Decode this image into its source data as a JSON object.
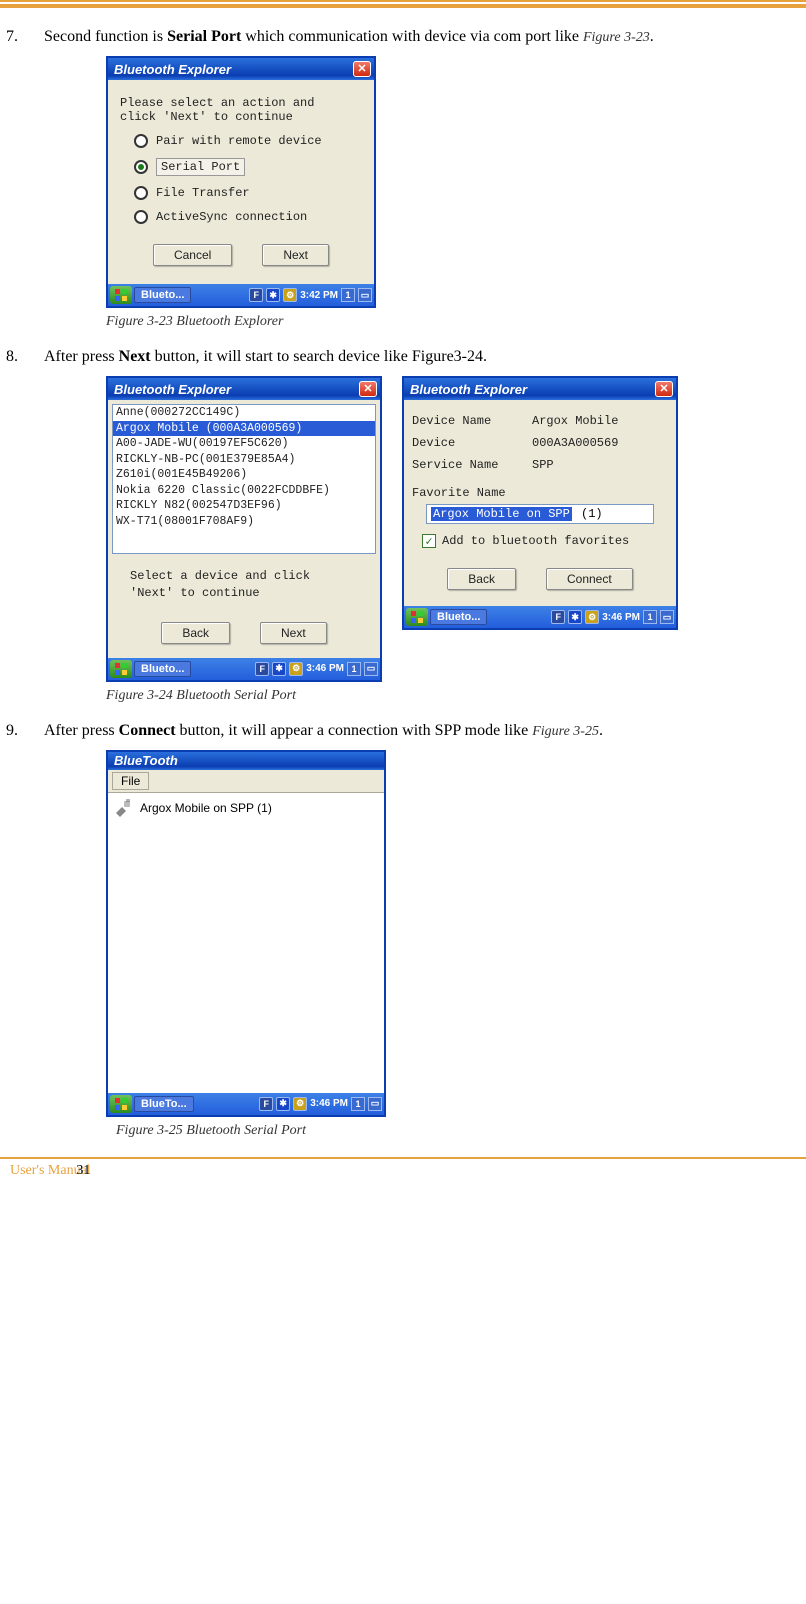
{
  "step7": {
    "num": "7.",
    "text_a": " Second function is ",
    "bold": "Serial Port",
    "text_b": " which communication with device via com port like ",
    "figref": "Figure 3-23",
    "text_c": "."
  },
  "fig23": {
    "title": "Bluetooth Explorer",
    "instr_a": "Please select an action and",
    "instr_b": "click 'Next'  to continue",
    "opt1": "Pair with remote device",
    "opt2": "Serial Port",
    "opt3": "File Transfer",
    "opt4": "ActiveSync connection",
    "cancel": "Cancel",
    "next": "Next",
    "task": "Blueto...",
    "clock": "3:42 PM",
    "caption": "Figure 3-23 Bluetooth Explorer"
  },
  "step8": {
    "num": "8.",
    "text_a": "After press ",
    "bold": "Next",
    "text_b": " button, it will start to search device like Figure3-24."
  },
  "fig24L": {
    "title": "Bluetooth Explorer",
    "devices": [
      "Anne(000272CC149C)",
      "Argox Mobile (000A3A000569)",
      "A00-JADE-WU(00197EF5C620)",
      "RICKLY-NB-PC(001E379E85A4)",
      "Z610i(001E45B49206)",
      "Nokia 6220 Classic(0022FCDDBFE)",
      "RICKLY N82(002547D3EF96)",
      "WX-T71(08001F708AF9)"
    ],
    "sel_index": 1,
    "instr_a": "Select a device and click",
    "instr_b": "'Next' to continue",
    "back": "Back",
    "next": "Next",
    "task": "Blueto...",
    "clock": "3:46 PM"
  },
  "fig24R": {
    "title": "Bluetooth Explorer",
    "k_devname": "Device Name",
    "v_devname": "Argox Mobile",
    "k_dev": "Device",
    "v_dev": "000A3A000569",
    "k_svc": "Service Name",
    "v_svc": "SPP",
    "favlabel": "Favorite Name",
    "favvalue_sel": "Argox Mobile  on SPP",
    "favvalue_tail": " (1)",
    "chklabel": "Add to bluetooth favorites",
    "back": "Back",
    "connect": "Connect",
    "task": "Blueto...",
    "clock": "3:46 PM"
  },
  "fig24_caption": "Figure 3-24 Bluetooth Serial Port",
  "step9": {
    "num": "9.",
    "text_a": "After press ",
    "bold": "Connect",
    "text_b": " button, it will appear a connection with SPP mode like ",
    "figref": "Figure 3-25",
    "text_c": "."
  },
  "fig25": {
    "title": "BlueTooth",
    "menu_file": "File",
    "conn": "Argox Mobile  on SPP (1)",
    "task": "BlueTo...",
    "clock": "3:46 PM",
    "caption": "Figure 3-25 Bluetooth Serial Port"
  },
  "footer": {
    "manual": "User's Manual",
    "page": "31"
  },
  "tray": {
    "f": "F",
    "one": "1"
  }
}
